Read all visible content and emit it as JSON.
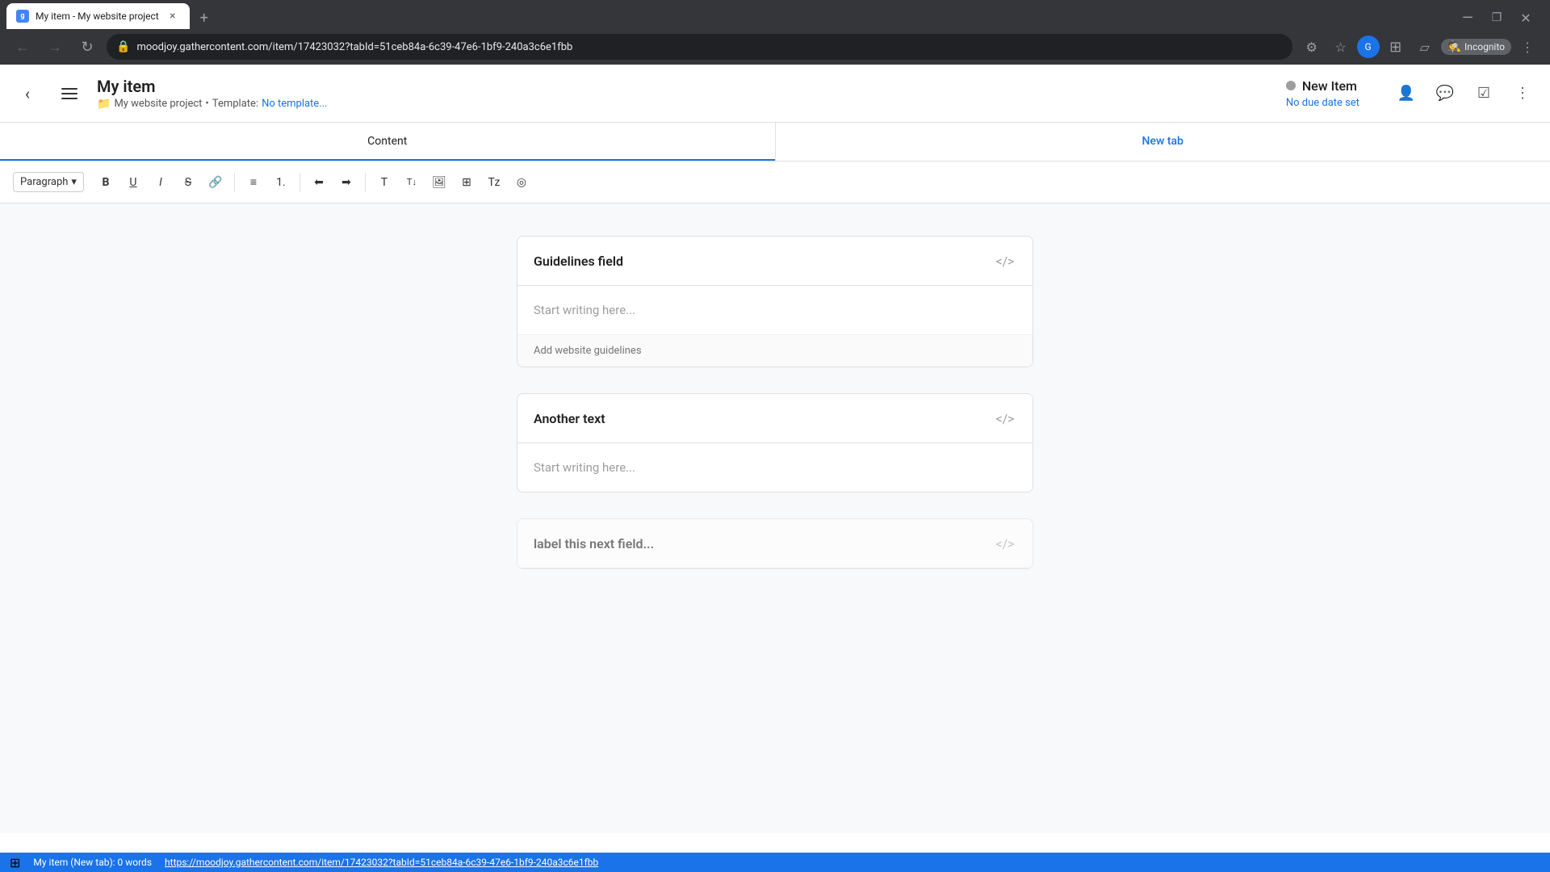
{
  "browser": {
    "tab_title": "My item - My website project",
    "tab_close": "×",
    "new_tab_icon": "+",
    "url": "moodjoy.gathercontent.com/item/17423032?tabId=51ceb84a-6c39-47e6-1bf9-240a3c6e1fbb",
    "window_minimize": "—",
    "window_restore": "❐",
    "window_close": "✕",
    "nav_back": "←",
    "nav_forward": "→",
    "nav_refresh": "↻",
    "incognito_label": "Incognito",
    "status_bar_text": "My item (New tab): 0 words",
    "status_bar_link": "https://moodjoy.gathercontent.com/item/17423032?tabId=51ceb84a-6c39-47e6-1bf9-240a3c6e1fbb"
  },
  "header": {
    "title": "My item",
    "project": "My website project",
    "template_label": "Template:",
    "template_value": "No template...",
    "status_label": "New Item",
    "due_date": "No due date set"
  },
  "tabs": {
    "content_tab": "Content",
    "new_tab": "New tab"
  },
  "toolbar": {
    "paragraph_label": "Paragraph",
    "bold": "B",
    "underline": "U",
    "italic": "I",
    "strikethrough": "S"
  },
  "fields": [
    {
      "id": "field-1",
      "title": "Guidelines field",
      "placeholder": "Start writing here...",
      "hint": "Add website guidelines"
    },
    {
      "id": "field-2",
      "title": "Another text",
      "placeholder": "Start writing here...",
      "hint": null
    },
    {
      "id": "field-3",
      "title": "label this next field...",
      "placeholder": "",
      "hint": null
    }
  ]
}
